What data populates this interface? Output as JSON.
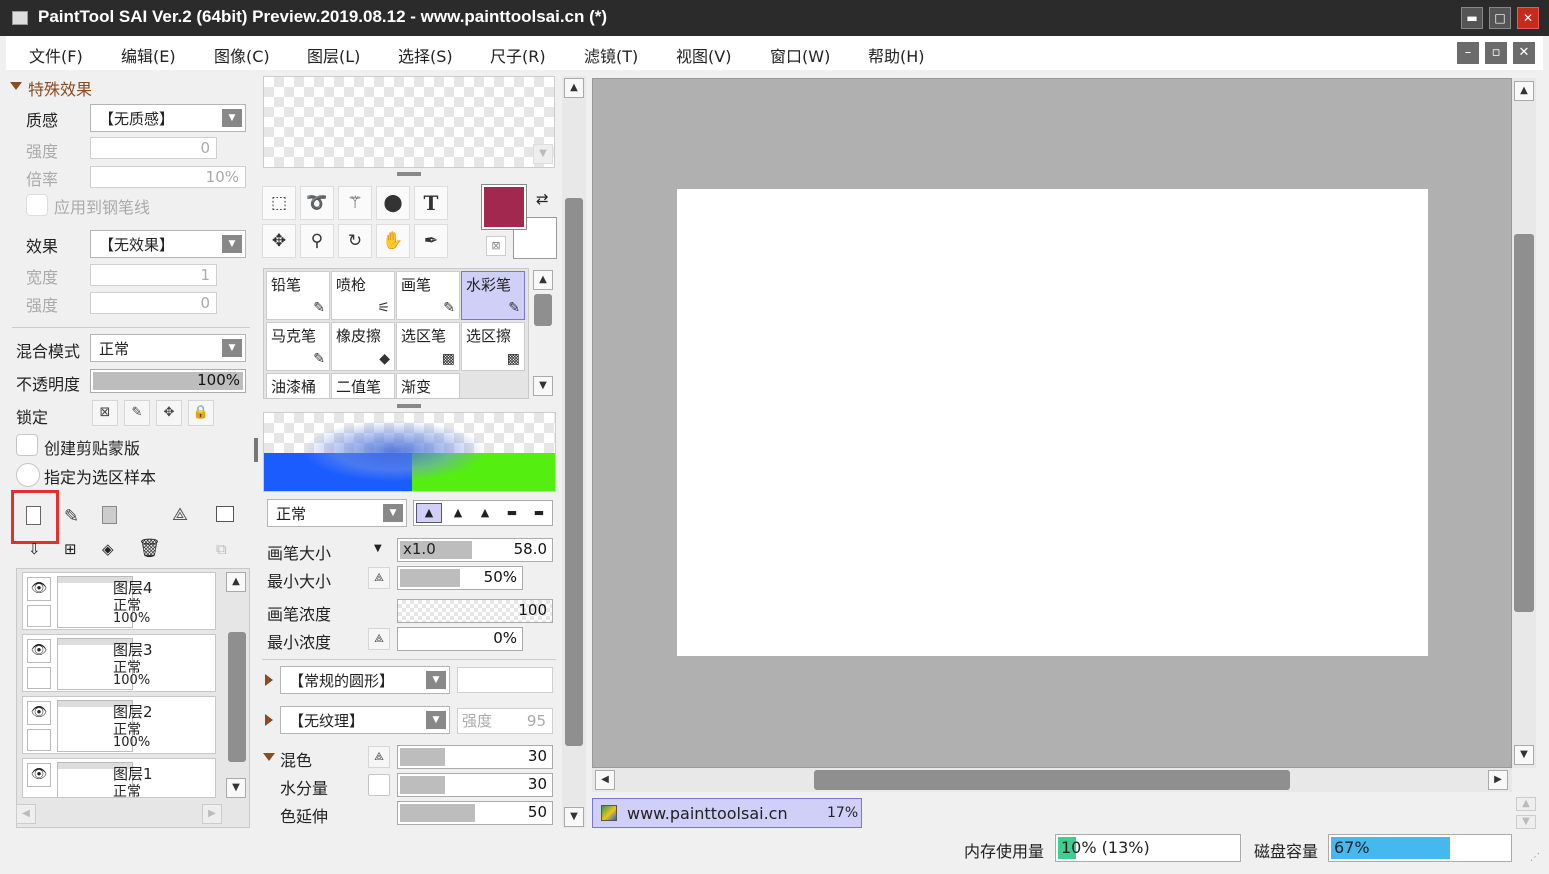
{
  "window": {
    "title": "PaintTool SAI Ver.2 (64bit) Preview.2019.08.12 - www.painttoolsai.cn (*)",
    "minimize": "▬",
    "maximize": "□",
    "close": "✕"
  },
  "menu": [
    "文件(F)",
    "编辑(E)",
    "图像(C)",
    "图层(L)",
    "选择(S)",
    "尺子(R)",
    "滤镜(T)",
    "视图(V)",
    "窗口(W)",
    "帮助(H)"
  ],
  "mdi": {
    "minimize": "–",
    "restore": "▫",
    "close": "✕"
  },
  "layer_panel": {
    "effects_header": "特殊效果",
    "texture_label": "质感",
    "texture_value": "【无质感】",
    "strength_label": "强度",
    "strength_value": "0",
    "scale_label": "倍率",
    "scale_value": "10%",
    "apply_pen": "应用到钢笔线",
    "effect_label": "效果",
    "effect_value": "【无效果】",
    "width_label": "宽度",
    "width_value": "1",
    "strength2_label": "强度",
    "strength2_value": "0",
    "blend_label": "混合模式",
    "blend_value": "正常",
    "opacity_label": "不透明度",
    "opacity_value": "100%",
    "opacity_fraction": 1.0,
    "lock_label": "锁定",
    "clip_label": "创建剪贴蒙版",
    "sample_label": "指定为选区样本",
    "layers": [
      {
        "name": "图层4",
        "mode": "正常",
        "opacity": "100%"
      },
      {
        "name": "图层3",
        "mode": "正常",
        "opacity": "100%"
      },
      {
        "name": "图层2",
        "mode": "正常",
        "opacity": "100%"
      },
      {
        "name": "图层1",
        "mode": "正常",
        "opacity": ""
      }
    ]
  },
  "tools": {
    "text_tool": "T",
    "primary_color": "#a3284f",
    "secondary_color": "#ffffff"
  },
  "brushes": [
    {
      "name": "铅笔",
      "icon": "✎"
    },
    {
      "name": "喷枪",
      "icon": "⚟"
    },
    {
      "name": "画笔",
      "icon": "✎"
    },
    {
      "name": "水彩笔",
      "icon": "✎"
    },
    {
      "name": "马克笔",
      "icon": "✎"
    },
    {
      "name": "橡皮擦",
      "icon": "◆"
    },
    {
      "name": "选区笔",
      "icon": "▩"
    },
    {
      "name": "选区擦",
      "icon": "▩"
    },
    {
      "name": "油漆桶",
      "icon": ""
    },
    {
      "name": "二值笔",
      "icon": ""
    },
    {
      "name": "渐变",
      "icon": ""
    }
  ],
  "brush_settings": {
    "blend_mode": "正常",
    "size_label": "画笔大小",
    "size_mult": "x1.0",
    "size_value": "58.0",
    "size_fraction": 0.48,
    "min_size_label": "最小大小",
    "min_size_value": "50%",
    "min_size_fraction": 0.5,
    "density_label": "画笔浓度",
    "density_value": "100",
    "min_density_label": "最小浓度",
    "min_density_value": "0%",
    "shape_value": "【常规的圆形】",
    "texture_value": "【无纹理】",
    "texture_strength_label": "强度",
    "texture_strength_value": "95",
    "mix_label": "混色",
    "mix_value": "30",
    "mix_fraction": 0.3,
    "water_label": "水分量",
    "water_value": "30",
    "water_fraction": 0.3,
    "stretch_label": "色延伸",
    "stretch_value": "50",
    "stretch_fraction": 0.5
  },
  "document": {
    "name": "www.painttoolsai.cn",
    "zoom": "17%"
  },
  "status": {
    "memory_label": "内存使用量",
    "memory_value": "10% (13%)",
    "memory_fraction": 0.1,
    "disk_label": "磁盘容量",
    "disk_value": "67%",
    "disk_fraction": 0.67
  },
  "colors": {
    "highlight": "#e03030",
    "selection": "#cfcff7",
    "memory_bar": "#3ecf8e",
    "disk_bar": "#46b8f0"
  }
}
